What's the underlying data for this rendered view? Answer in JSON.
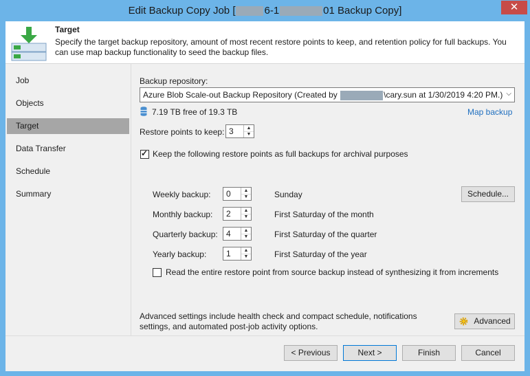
{
  "window": {
    "title_prefix": "Edit Backup Copy Job [",
    "title_mid": "6-1",
    "title_suffix": "01 Backup Copy]",
    "close_label": "✕"
  },
  "header": {
    "title": "Target",
    "description": "Specify the target backup repository, amount of most recent restore points to keep, and retention policy for full backups. You can use map backup functionality to seed the backup files."
  },
  "nav": {
    "items": [
      {
        "label": "Job"
      },
      {
        "label": "Objects"
      },
      {
        "label": "Target"
      },
      {
        "label": "Data Transfer"
      },
      {
        "label": "Schedule"
      },
      {
        "label": "Summary"
      }
    ],
    "active": "Target"
  },
  "target": {
    "repo_label": "Backup repository:",
    "repo_value_prefix": "Azure Blob Scale-out Backup Repository (Created by",
    "repo_value_suffix": "\\cary.sun at 1/30/2019 4:20 PM.)",
    "free_space": "7.19 TB free of 19.3 TB",
    "map_backup_link": "Map backup",
    "restore_points_label": "Restore points to keep:",
    "restore_points_value": "3",
    "keep_full_label": "Keep the following restore points as full backups for archival purposes",
    "keep_full_checked": true,
    "gfs": [
      {
        "label": "Weekly backup:",
        "value": "0",
        "desc": "Sunday"
      },
      {
        "label": "Monthly backup:",
        "value": "2",
        "desc": "First Saturday of the month"
      },
      {
        "label": "Quarterly backup:",
        "value": "4",
        "desc": "First Saturday of the quarter"
      },
      {
        "label": "Yearly backup:",
        "value": "1",
        "desc": "First Saturday of the year"
      }
    ],
    "schedule_button": "Schedule...",
    "read_entire_label": "Read the entire restore point from source backup instead of synthesizing it from increments",
    "read_entire_checked": false,
    "advanced_text": "Advanced settings include health check and compact schedule, notifications settings, and automated post-job activity options.",
    "advanced_button": "Advanced"
  },
  "footer": {
    "previous": "< Previous",
    "next": "Next >",
    "finish": "Finish",
    "cancel": "Cancel"
  },
  "colors": {
    "window_border": "#6cb4e8",
    "close_button": "#c74b48",
    "nav_active": "#a6a6a6",
    "link": "#1f6fbf",
    "icon_green": "#3aa845"
  }
}
